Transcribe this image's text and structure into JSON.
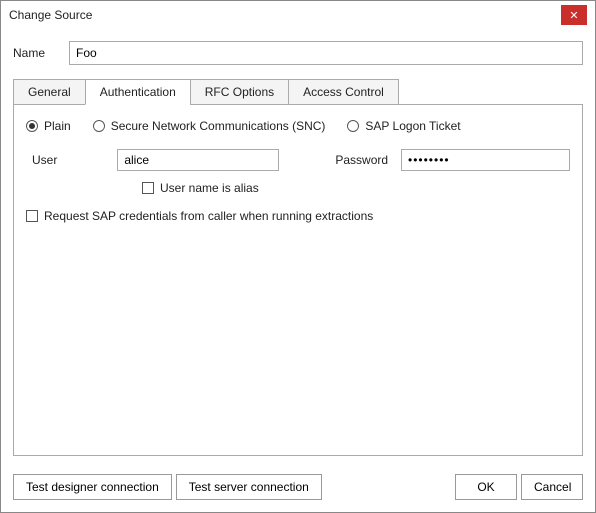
{
  "window": {
    "title": "Change Source"
  },
  "name": {
    "label": "Name",
    "value": "Foo"
  },
  "tabs": {
    "general": "General",
    "authentication": "Authentication",
    "rfc_options": "RFC Options",
    "access_control": "Access Control"
  },
  "auth": {
    "mode_plain": "Plain",
    "mode_snc": "Secure Network Communications (SNC)",
    "mode_ticket": "SAP Logon Ticket",
    "user_label": "User",
    "user_value": "alice",
    "password_label": "Password",
    "password_value": "••••••••",
    "alias_label": "User name is alias",
    "request_creds_label": "Request SAP credentials from caller when running extractions"
  },
  "buttons": {
    "test_designer": "Test designer connection",
    "test_server": "Test server connection",
    "ok": "OK",
    "cancel": "Cancel"
  }
}
